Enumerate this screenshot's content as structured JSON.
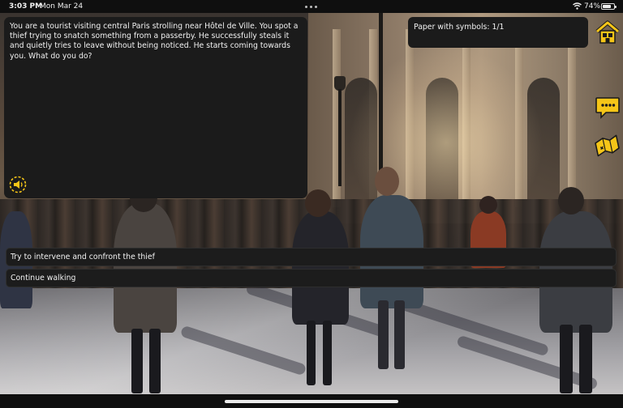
{
  "status_bar": {
    "time": "3:03 PM",
    "date": "Mon Mar 24",
    "battery_percent": "74%",
    "battery_level": 0.74,
    "icons": [
      "multitasking-dots-icon",
      "wifi-icon",
      "battery-icon"
    ]
  },
  "story": {
    "text": "You are a tourist visiting central Paris strolling near Hôtel de Ville. You spot a thief trying to snatch something from a passerby. He successfully steals it and quietly tries to leave without being noticed. He starts coming towards you. What do you do?",
    "audio_icon": "speaker-icon"
  },
  "inventory": {
    "text": "Paper with symbols: 1/1"
  },
  "side_buttons": {
    "home_icon": "home-icon",
    "chat_icon": "chat-bubble-icon",
    "map_icon": "treasure-map-icon"
  },
  "choices": [
    {
      "label": "Try to intervene and confront the thief"
    },
    {
      "label": "Continue walking"
    }
  ],
  "colors": {
    "panel_bg": "#1b1b1b",
    "accent_yellow": "#f5c518",
    "text": "#f2f2f2"
  }
}
